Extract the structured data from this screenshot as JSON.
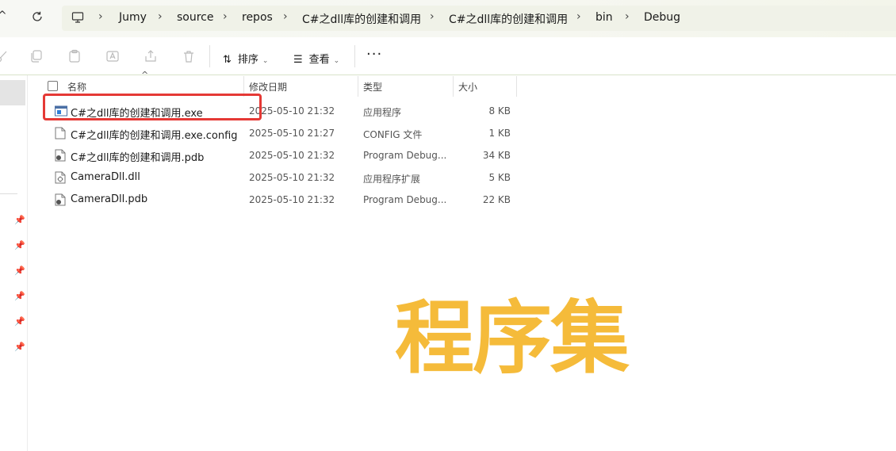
{
  "breadcrumb": [
    "Jumy",
    "source",
    "repos",
    "C#之dll库的创建和调用",
    "C#之dll库的创建和调用",
    "bin",
    "Debug"
  ],
  "toolbar": {
    "sort_label": "排序",
    "view_label": "查看",
    "more_label": "···"
  },
  "columns": {
    "name": "名称",
    "modified": "修改日期",
    "type": "类型",
    "size": "大小"
  },
  "files": [
    {
      "name": "C#之dll库的创建和调用.exe",
      "modified": "2025-05-10 21:32",
      "type": "应用程序",
      "size": "8 KB",
      "icon": "exe-icon"
    },
    {
      "name": "C#之dll库的创建和调用.exe.config",
      "modified": "2025-05-10 21:27",
      "type": "CONFIG 文件",
      "size": "1 KB",
      "icon": "file-icon"
    },
    {
      "name": "C#之dll库的创建和调用.pdb",
      "modified": "2025-05-10 21:32",
      "type": "Program Debug...",
      "size": "34 KB",
      "icon": "pdb-icon"
    },
    {
      "name": "CameraDll.dll",
      "modified": "2025-05-10 21:32",
      "type": "应用程序扩展",
      "size": "5 KB",
      "icon": "dll-icon"
    },
    {
      "name": "CameraDll.pdb",
      "modified": "2025-05-10 21:32",
      "type": "Program Debug...",
      "size": "22 KB",
      "icon": "pdb-icon"
    }
  ],
  "annotation": {
    "label": "程序集",
    "label_color": "#f5bb3a",
    "highlight_color": "#e53935"
  },
  "colors": {
    "address_bg": "#f0f2e8",
    "selected_bg": "#e4e4e4"
  }
}
